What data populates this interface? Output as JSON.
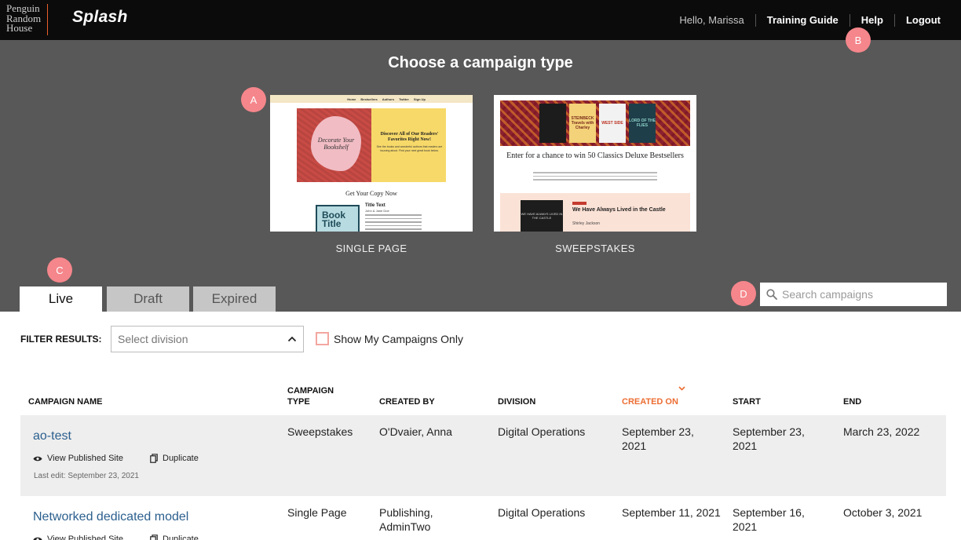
{
  "header": {
    "logo_lines": [
      "Penguin",
      "Random",
      "House"
    ],
    "brand": "Splash",
    "nav": {
      "greeting": "Hello, Marissa",
      "training_guide": "Training Guide",
      "help": "Help",
      "logout": "Logout"
    }
  },
  "hero": {
    "title": "Choose a campaign type",
    "cards": [
      {
        "label": "SINGLE PAGE",
        "preview": {
          "nav": [
            "Home",
            "Bestsellers",
            "Authors",
            "Twitter",
            "Sign Up"
          ],
          "blob_text": "Decorate Your Bookshelf",
          "headline": "Discover All of Our Readers' Favorites Right Now!",
          "blurb": "See the books and wonderful authors that readers are buzzing about. Find your next great book below.",
          "get_copy": "Get Your Copy Now",
          "book_cover": "Book Title",
          "title_text": "Title Text",
          "author": "John & Jane Doe"
        }
      },
      {
        "label": "SWEEPSTAKES",
        "preview": {
          "covers": [
            "",
            "STEINBECK Travels with Charley",
            "WEST SIDE",
            "LORD OF THE FLIES"
          ],
          "headline": "Enter for a chance to win 50 Classics Deluxe Bestsellers",
          "feature_cover": "WE HAVE ALWAYS LIVED IN THE CASTLE",
          "feature_title": "We Have Always Lived in the Castle",
          "feature_author": "Shirley Jackson"
        }
      }
    ]
  },
  "badges": {
    "a": "A",
    "b": "B",
    "c": "C",
    "d": "D"
  },
  "tabs": [
    "Live",
    "Draft",
    "Expired"
  ],
  "search": {
    "placeholder": "Search campaigns",
    "value": ""
  },
  "filter": {
    "label": "FILTER RESULTS:",
    "division_placeholder": "Select division",
    "my_campaigns_label": "Show My Campaigns Only",
    "my_campaigns_checked": false
  },
  "table": {
    "headers": {
      "name": "CAMPAIGN NAME",
      "type": "CAMPAIGN TYPE",
      "created_by": "CREATED BY",
      "division": "DIVISION",
      "created_on": "CREATED ON",
      "start": "START",
      "end": "END"
    },
    "sorted_column": "created_on",
    "actions": {
      "view": "View Published Site",
      "duplicate": "Duplicate"
    },
    "rows": [
      {
        "name": "ao-test",
        "type": "Sweepstakes",
        "created_by": "O'Dvaier, Anna",
        "division": "Digital Operations",
        "created_on": "September 23, 2021",
        "start": "September 23, 2021",
        "end": "March 23, 2022",
        "last_edit": "Last edit: September 23, 2021"
      },
      {
        "name": "Networked dedicated model",
        "type": "Single Page",
        "created_by": "Publishing, AdminTwo",
        "division": "Digital Operations",
        "created_on": "September 11, 2021",
        "start": "September 16, 2021",
        "end": "October 3, 2021"
      }
    ]
  },
  "colors": {
    "topbar": "#0b0b0b",
    "hero": "#585858",
    "badge": "#f5868b",
    "link": "#2b5f8e",
    "sorted_header": "#ec6d32",
    "logo_rule": "#e85f2b"
  }
}
